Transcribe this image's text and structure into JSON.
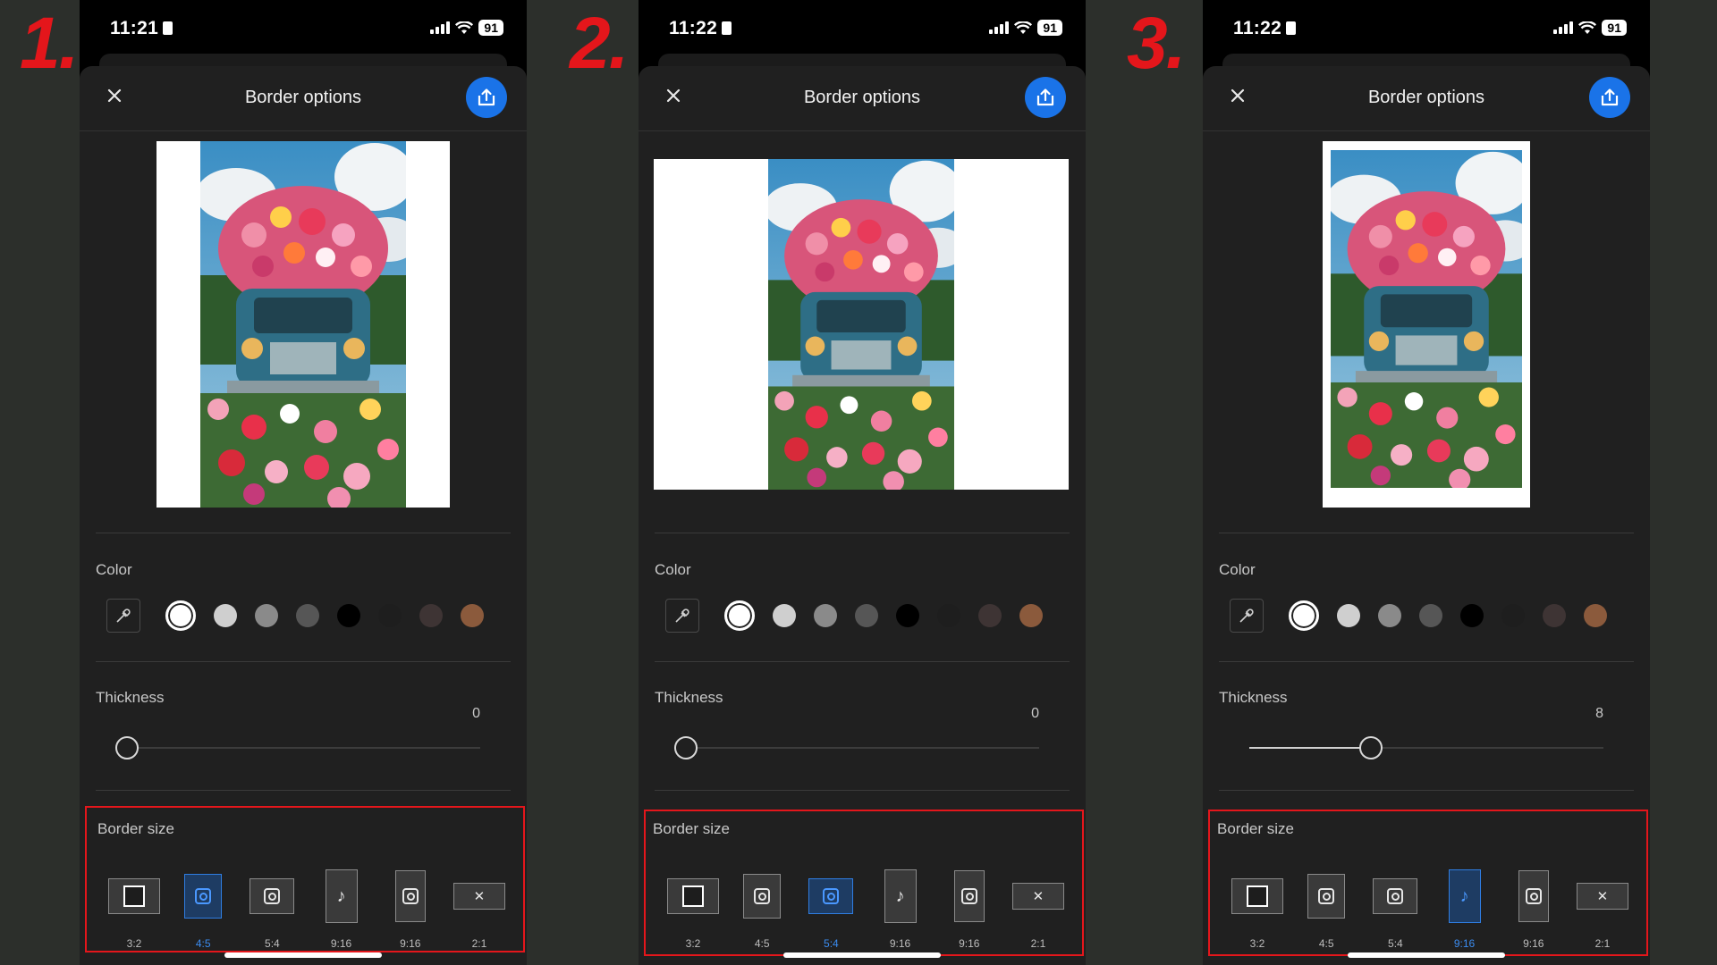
{
  "step_numbers": [
    "1.",
    "2.",
    "3."
  ],
  "panels": [
    {
      "status": {
        "time": "11:21",
        "battery": "91"
      },
      "title": "Border options",
      "color_label": "Color",
      "thickness_label": "Thickness",
      "thickness_value": "0",
      "thickness_level": 0,
      "border_size_label": "Border size",
      "selected_size": "4:5",
      "size_options": [
        {
          "label": "3:2",
          "icon": "square-frame-icon"
        },
        {
          "label": "4:5",
          "icon": "instagram-icon"
        },
        {
          "label": "5:4",
          "icon": "instagram-icon"
        },
        {
          "label": "9:16",
          "icon": "tiktok-icon"
        },
        {
          "label": "9:16",
          "icon": "instagram-icon"
        },
        {
          "label": "2:1",
          "icon": "x-icon"
        }
      ]
    },
    {
      "status": {
        "time": "11:22",
        "battery": "91"
      },
      "title": "Border options",
      "color_label": "Color",
      "thickness_label": "Thickness",
      "thickness_value": "0",
      "thickness_level": 0,
      "border_size_label": "Border size",
      "selected_size": "5:4",
      "size_options": [
        {
          "label": "3:2",
          "icon": "square-frame-icon"
        },
        {
          "label": "4:5",
          "icon": "instagram-icon"
        },
        {
          "label": "5:4",
          "icon": "instagram-icon"
        },
        {
          "label": "9:16",
          "icon": "tiktok-icon"
        },
        {
          "label": "9:16",
          "icon": "instagram-icon"
        },
        {
          "label": "2:1",
          "icon": "x-icon"
        }
      ]
    },
    {
      "status": {
        "time": "11:22",
        "battery": "91"
      },
      "title": "Border options",
      "color_label": "Color",
      "thickness_label": "Thickness",
      "thickness_value": "8",
      "thickness_level": 0.34,
      "border_size_label": "Border size",
      "selected_size": "9:16 (TikTok)",
      "size_options": [
        {
          "label": "3:2",
          "icon": "square-frame-icon"
        },
        {
          "label": "4:5",
          "icon": "instagram-icon"
        },
        {
          "label": "5:4",
          "icon": "instagram-icon"
        },
        {
          "label": "9:16",
          "icon": "tiktok-icon"
        },
        {
          "label": "9:16",
          "icon": "instagram-icon"
        },
        {
          "label": "2:1",
          "icon": "x-icon"
        }
      ]
    }
  ],
  "color_swatches": [
    "#ffffff",
    "#cfcfcf",
    "#8a8a8a",
    "#565656",
    "#000000",
    "#1e1e1e",
    "#3e3434",
    "#8b5a3c"
  ],
  "colors": {
    "accent": "#1a73e8",
    "highlight_box": "#e4161b",
    "step_number": "#e4161b"
  }
}
